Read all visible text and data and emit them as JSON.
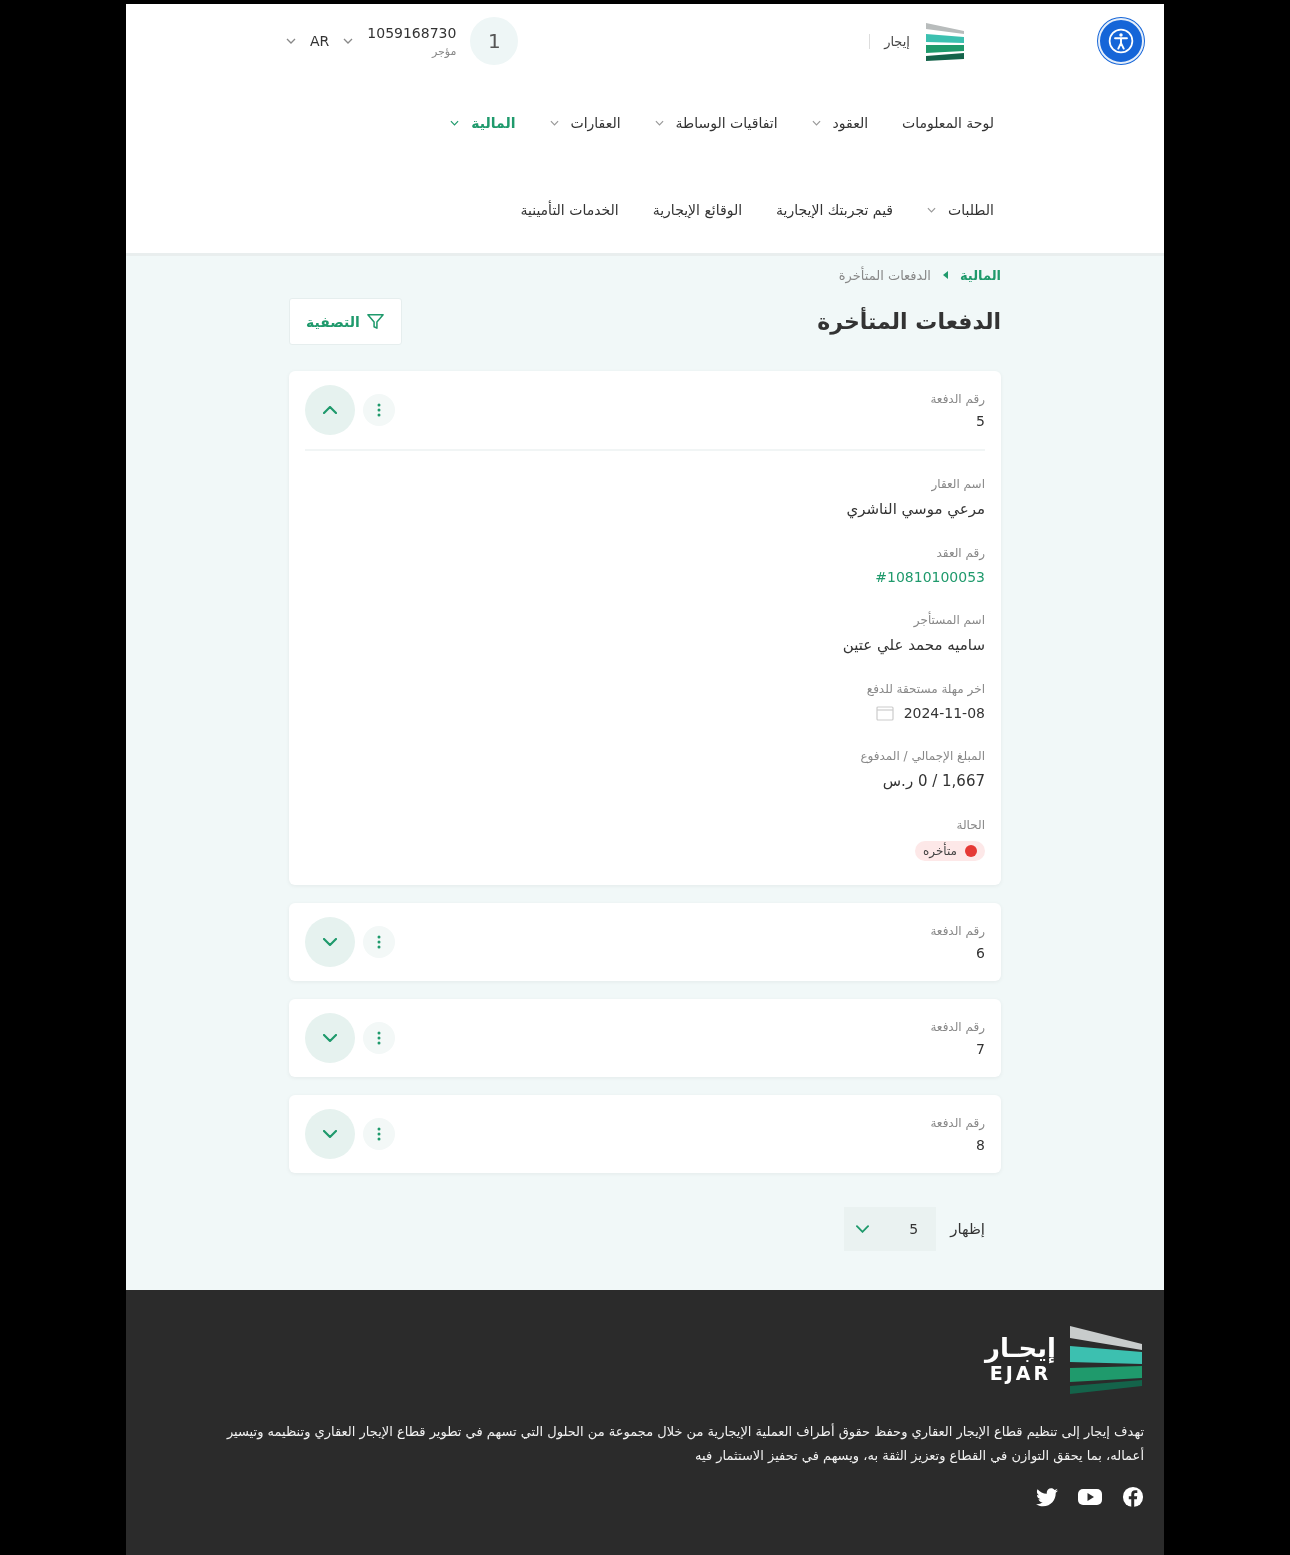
{
  "header": {
    "brand_label": "إيجار",
    "notification_count": "1",
    "account_number": "1059168730",
    "account_role": "مؤجر",
    "language": "AR"
  },
  "nav_rows": [
    [
      {
        "label": "لوحة المعلومات",
        "has_menu": false,
        "selected": false
      },
      {
        "label": "العقود",
        "has_menu": true,
        "selected": false
      },
      {
        "label": "اتفاقيات الوساطة",
        "has_menu": true,
        "selected": false
      },
      {
        "label": "العقارات",
        "has_menu": true,
        "selected": false
      },
      {
        "label": "المالية",
        "has_menu": true,
        "selected": true
      }
    ],
    [
      {
        "label": "الطلبات",
        "has_menu": true,
        "selected": false
      },
      {
        "label": "قيم تجربتك الإيجارية",
        "has_menu": false,
        "selected": false
      },
      {
        "label": "الوقائع الإيجارية",
        "has_menu": false,
        "selected": false
      },
      {
        "label": "الخدمات التأمينية",
        "has_menu": false,
        "selected": false
      }
    ]
  ],
  "breadcrumb": [
    "المالية",
    "الدفعات المتأخرة"
  ],
  "page_title": "الدفعات المتأخرة",
  "filter_button": "التصفية",
  "payments": [
    {
      "number_label": "رقم الدفعة",
      "number": "5",
      "expanded": true,
      "details": [
        {
          "kind": "text",
          "label": "اسم العقار",
          "value": "مرعي موسي الناشري"
        },
        {
          "kind": "link",
          "label": "رقم العقد",
          "value": "#10810100053"
        },
        {
          "kind": "text",
          "label": "اسم المستأجر",
          "value": "ساميه محمد علي عتين"
        },
        {
          "kind": "date",
          "label": "اخر مهلة مستحقة للدفع",
          "value": "2024-11-08"
        },
        {
          "kind": "text",
          "label": "المبلغ الإجمالي / المدفوع",
          "value": "1,667  /  0 ر.س"
        },
        {
          "kind": "status",
          "label": "الحالة",
          "value": "متأخره",
          "color": "#e53935"
        }
      ]
    },
    {
      "number_label": "رقم الدفعة",
      "number": "6",
      "expanded": false
    },
    {
      "number_label": "رقم الدفعة",
      "number": "7",
      "expanded": false
    },
    {
      "number_label": "رقم الدفعة",
      "number": "8",
      "expanded": false
    }
  ],
  "page_size": {
    "label": "إظهار",
    "value": "5"
  },
  "footer": {
    "logo_ar": "إيجـار",
    "logo_en": "EJAR",
    "description": "تهدف إيجار إلى تنظيم قطاع الإيجار العقاري وحفظ حقوق أطراف العملية الإيجارية من خلال مجموعة من الحلول التي تسهم في تطوير قطاع الإيجار العقاري وتنظيمه وتيسير أعماله، بما يحقق التوازن في القطاع وتعزيز الثقة به، ويسهم في تحفيز الاستثمار فيه"
  }
}
